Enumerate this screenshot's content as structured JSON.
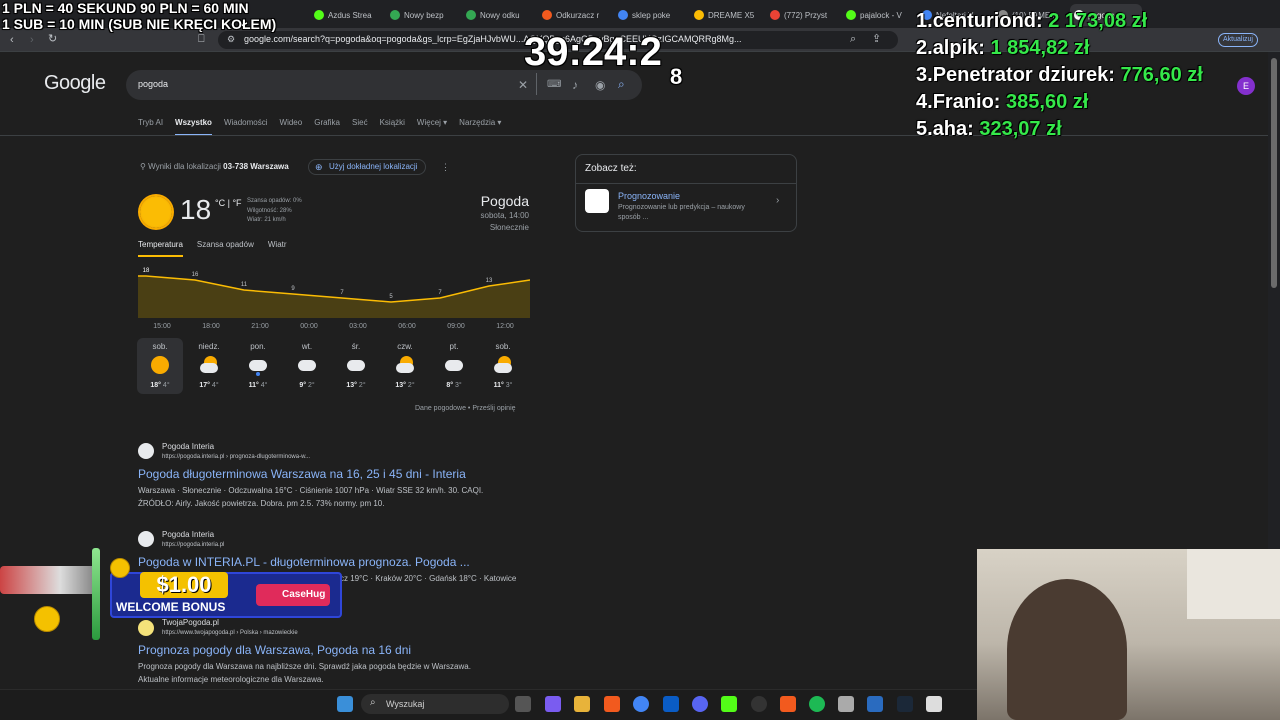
{
  "browser": {
    "tabs": [
      "Azdus Strea",
      "Nowy bezp",
      "Nowy odku",
      "Odkurzacz r",
      "sklep poke",
      "DREAME X5",
      "(772) Przyst",
      "pajalock - V",
      "Nefeltari V.",
      "(10) FAME |",
      "pogoda"
    ],
    "url": "google.com/search?q=pogoda&oq=pogoda&gs_lcrp=EgZjaHJvbWU...AQYQBgc6AgGDsyBggCEEUYOzIGCAMQRRg8Mg...",
    "update_label": "Aktualizuj",
    "avatar_letter": "E"
  },
  "overlay": {
    "line1": "1 PLN = 40 SEKUND 90 PLN = 60 MIN",
    "line2": "1 SUB = 10 MIN (SUB NIE KRĘCI KOŁEM)",
    "timer": "39:24:2",
    "timer_tail": "8",
    "leaderboard": [
      {
        "rank": "1.",
        "name": "centuriond:",
        "amount": "2 173,08 zł"
      },
      {
        "rank": "2.",
        "name": "alpik:",
        "amount": "1 854,82 zł"
      },
      {
        "rank": "3.",
        "name": "Penetrator dziurek:",
        "amount": "776,60 zł"
      },
      {
        "rank": "4.",
        "name": "Franio:",
        "amount": "385,60 zł"
      },
      {
        "rank": "5.",
        "name": "aha:",
        "amount": "323,07 zł"
      }
    ]
  },
  "google": {
    "logo": "Google",
    "query": "pogoda",
    "tabs": [
      "Tryb AI",
      "Wszystko",
      "Wiadomości",
      "Wideo",
      "Grafika",
      "Sieć",
      "Książki",
      "Więcej ▾",
      "Narzędzia ▾"
    ],
    "location_text": "Wyniki dla lokalizacji",
    "location_code": "03-738 Warszawa",
    "location_button": "Użyj dokładnej lokalizacji"
  },
  "weather": {
    "temp": "18",
    "unit": "°C | °F",
    "details": [
      "Szansa opadów: 0%",
      "Wilgotność: 28%",
      "Wiatr: 21 km/h"
    ],
    "title": "Pogoda",
    "when": "sobota, 14:00",
    "condition": "Słonecznie",
    "tabs": [
      "Temperatura",
      "Szansa opadów",
      "Wiatr"
    ],
    "hourly_temps": [
      18,
      16,
      11,
      9,
      7,
      5,
      7,
      13
    ],
    "hourly_labels": [
      "15:00",
      "18:00",
      "21:00",
      "00:00",
      "03:00",
      "06:00",
      "09:00",
      "12:00"
    ],
    "days": [
      {
        "name": "sob.",
        "hi": "18°",
        "lo": "4°",
        "icon": "sun-icon"
      },
      {
        "name": "niedz.",
        "hi": "17°",
        "lo": "4°",
        "icon": "partly-cloudy-icon"
      },
      {
        "name": "pon.",
        "hi": "11°",
        "lo": "4°",
        "icon": "cloud-rain-icon"
      },
      {
        "name": "wt.",
        "hi": "9°",
        "lo": "2°",
        "icon": "cloud-icon"
      },
      {
        "name": "śr.",
        "hi": "13°",
        "lo": "2°",
        "icon": "cloud-icon"
      },
      {
        "name": "czw.",
        "hi": "13°",
        "lo": "2°",
        "icon": "partly-cloudy-icon"
      },
      {
        "name": "pt.",
        "hi": "8°",
        "lo": "3°",
        "icon": "cloud-icon"
      },
      {
        "name": "sob.",
        "hi": "11°",
        "lo": "3°",
        "icon": "partly-cloudy-icon"
      }
    ],
    "links": "Dane pogodowe  •  Prześlij opinię"
  },
  "see_also": {
    "title": "Zobacz też:",
    "name": "Prognozowanie",
    "desc": "Prognozowanie lub predykcja – naukowy sposób ..."
  },
  "results": [
    {
      "site": "Pogoda Interia",
      "url": "https://pogoda.interia.pl › prognoza-dlugoterminowa-w...",
      "title": "Pogoda długoterminowa Warszawa na 16, 25 i 45 dni - Interia",
      "snippet1": "Warszawa · Słonecznie · Odczuwalna 16°C · Ciśnienie 1007 hPa · Wiatr SSE 32 km/h. 30. CAQI.",
      "snippet2": "ŹRÓDŁO: Airly. Jakość powietrza. Dobra. pm 2.5. 73% normy. pm 10."
    },
    {
      "site": "Pogoda Interia",
      "url": "https://pogoda.interia.pl",
      "title": "Pogoda w INTERIA.PL - długoterminowa prognoza. Pogoda ...",
      "snippet1": "cz 19°C · Kraków 20°C · Gdańsk 18°C · Katowice",
      "snippet2": ""
    },
    {
      "site": "TwojaPogoda.pl",
      "url": "https://www.twojapogoda.pl › Polska › mazowieckie",
      "title": "Prognoza pogody dla Warszawa, Pogoda na 16 dni",
      "snippet1": "Prognoza pogody dla Warszawa na najbliższe dni. Sprawdź jaka pogoda będzie w Warszawa.",
      "snippet2": "Aktualne informacje meteorologiczne dla Warszawa."
    }
  ],
  "promo": {
    "amount": "$1.00",
    "text": "WELCOME BONUS",
    "brand": "CaseHug"
  },
  "taskbar": {
    "search_label": "Wyszukaj"
  }
}
